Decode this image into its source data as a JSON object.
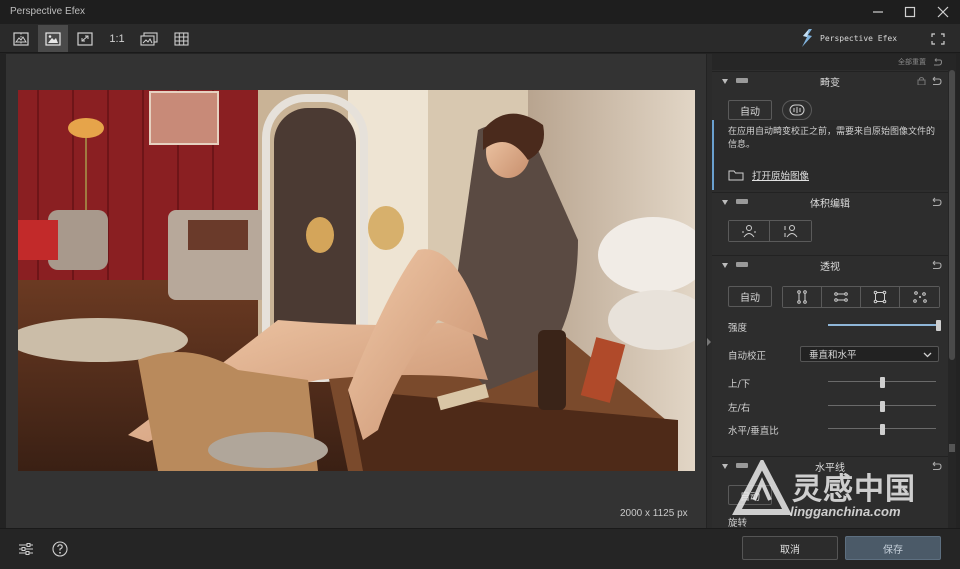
{
  "window": {
    "title": "Perspective Efex",
    "minimize_icon": "minimize-icon",
    "maximize_icon": "maximize-icon",
    "close_icon": "close-icon"
  },
  "toolbar": {
    "buttons": [
      {
        "name": "split-view-icon"
      },
      {
        "name": "single-view-icon",
        "active": true
      },
      {
        "name": "fit-screen-icon"
      },
      {
        "name": "actual-size",
        "label": "1:1"
      },
      {
        "name": "compare-icon"
      },
      {
        "name": "grid-icon"
      }
    ],
    "brand": "Perspective Efex",
    "fullscreen_icon": "fullscreen-icon"
  },
  "preview": {
    "image_size": "2000 x 1125 px"
  },
  "panel": {
    "reset_all": "全部重置",
    "sections": {
      "distortion": {
        "title": "畸变",
        "auto_label": "自动",
        "info_text": "在应用自动畸变校正之前，需要来自原始图像文件的信息。",
        "open_original": "打开原始图像"
      },
      "volume": {
        "title": "体积编辑"
      },
      "perspective": {
        "title": "透视",
        "auto_label": "自动",
        "strength_label": "强度",
        "strength_value": 1.0,
        "auto_correct_label": "自动校正",
        "auto_correct_value": "垂直和水平",
        "up_down_label": "上/下",
        "up_down_value": 0.5,
        "left_right_label": "左/右",
        "left_right_value": 0.5,
        "ratio_label": "水平/垂直比",
        "ratio_value": 0.5
      },
      "horizon": {
        "title": "水平线",
        "auto_label": "自动",
        "rotate_label": "旋转"
      }
    }
  },
  "footer": {
    "settings_icon": "settings-sliders-icon",
    "help_icon": "help-icon",
    "cancel_label": "取消",
    "save_label": "保存"
  },
  "watermark": {
    "main": "灵感中国",
    "sub": "lingganchina.com"
  },
  "colors": {
    "accent": "#6aa0cf",
    "save_button": "#4b5a68"
  }
}
